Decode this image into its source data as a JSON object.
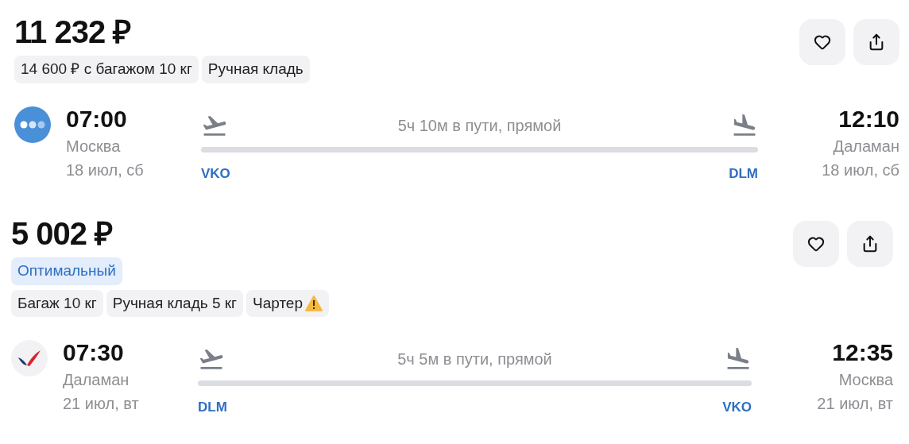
{
  "offers": [
    {
      "price": "11 232 ₽",
      "tags": [
        {
          "label": "14 600 ₽ с багажом 10 кг",
          "warning": false
        },
        {
          "label": "Ручная кладь",
          "warning": false
        }
      ],
      "flight": {
        "logo": {
          "kind": "dots"
        },
        "depart_time": "07:00",
        "depart_city": "Москва",
        "depart_date": "18 июл, сб",
        "duration": "5ч 10м в пути, прямой",
        "from_code": "VKO",
        "to_code": "DLM",
        "arrive_time": "12:10",
        "arrive_city": "Даламан",
        "arrive_date": "18 июл, сб"
      }
    },
    {
      "price": "5 002 ₽",
      "badge": "Оптимальный",
      "tags": [
        {
          "label": "Багаж 10 кг",
          "warning": false
        },
        {
          "label": "Ручная кладь 5 кг",
          "warning": false
        },
        {
          "label": "Чартер",
          "warning": true
        }
      ],
      "flight": {
        "logo": {
          "kind": "wing"
        },
        "depart_time": "07:30",
        "depart_city": "Даламан",
        "depart_date": "21 июл, вт",
        "duration": "5ч 5м в пути, прямой",
        "from_code": "DLM",
        "to_code": "VKO",
        "arrive_time": "12:35",
        "arrive_city": "Москва",
        "arrive_date": "21 июл, вт"
      }
    }
  ]
}
